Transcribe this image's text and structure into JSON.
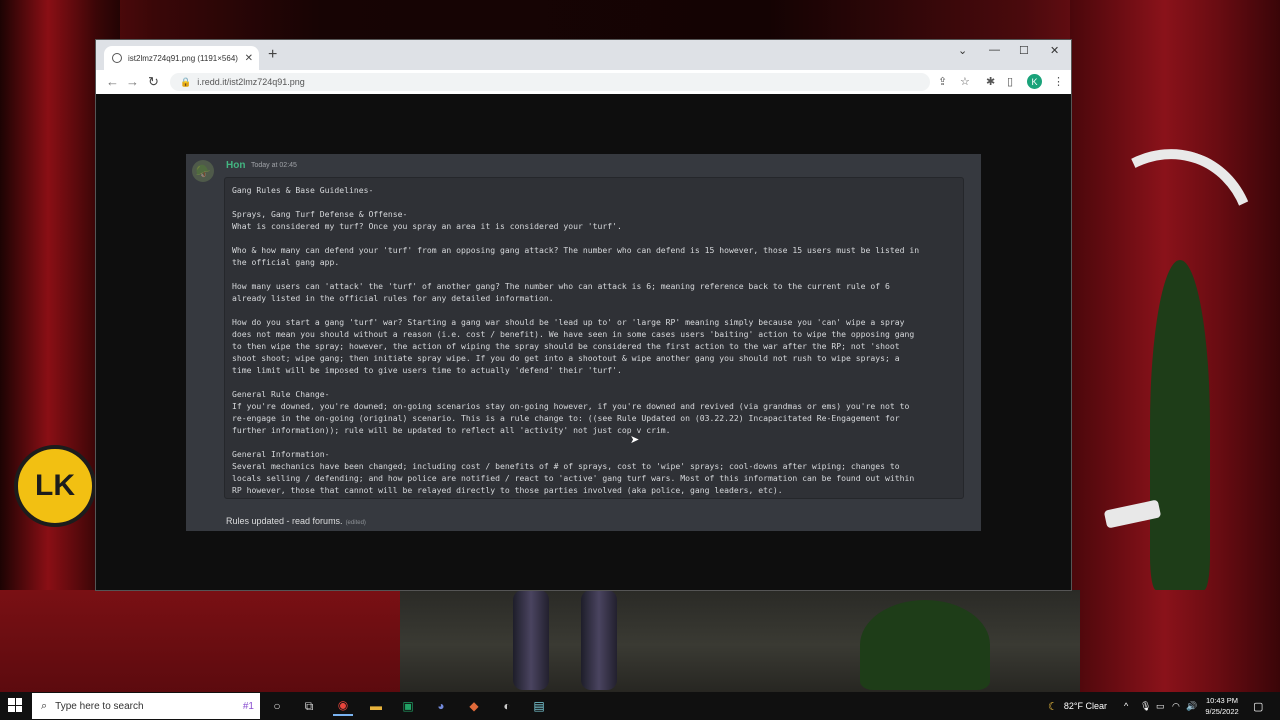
{
  "browser": {
    "tab_title": "ist2lmz724q91.png (1191×564)",
    "url": "i.redd.it/ist2lmz724q91.png",
    "profile_initial": "K"
  },
  "message": {
    "author": "Hon",
    "timestamp": "Today at 02:45",
    "body": "Gang Rules & Base Guidelines-\n\nSprays, Gang Turf Defense & Offense-\nWhat is considered my turf? Once you spray an area it is considered your 'turf'.\n\nWho & how many can defend your 'turf' from an opposing gang attack? The number who can defend is 15 however, those 15 users must be listed in\nthe official gang app.\n\nHow many users can 'attack' the 'turf' of another gang? The number who can attack is 6; meaning reference back to the current rule of 6\nalready listed in the official rules for any detailed information.\n\nHow do you start a gang 'turf' war? Starting a gang war should be 'lead up to' or 'large RP' meaning simply because you 'can' wipe a spray\ndoes not mean you should without a reason (i.e. cost / benefit). We have seen in some cases users 'baiting' action to wipe the opposing gang\nto then wipe the spray; however, the action of wiping the spray should be considered the first action to the war after the RP; not 'shoot\nshoot shoot; wipe gang; then initiate spray wipe. If you do get into a shootout & wipe another gang you should not rush to wipe sprays; a\ntime limit will be imposed to give users time to actually 'defend' their 'turf'.\n\nGeneral Rule Change-\nIf you're downed, you're downed; on-going scenarios stay on-going however, if you're downed and revived (via grandmas or ems) you're not to\nre-engage in the on-going (original) scenario. This is a rule change to: ((see Rule Updated on (03.22.22) Incapacitated Re-Engagement for\nfurther information)); rule will be updated to reflect all 'activity' not just cop v crim.\n\nGeneral Information-\nSeveral mechanics have been changed; including cost / benefits of # of sprays, cost to 'wipe' sprays; cool-downs after wiping; changes to\nlocals selling / defending; and how police are notified / react to 'active' gang turf wars. Most of this information can be found out within\nRP however, those that cannot will be relayed directly to those parties involved (aka police, gang leaders, etc).",
    "footer": "Rules updated - read forums.",
    "edited": "(edited)"
  },
  "desktop": {
    "badge_text": "LK"
  },
  "taskbar": {
    "search_placeholder": "Type here to search",
    "search_deco": "#1",
    "weather": "82°F  Clear",
    "time": "10:43 PM",
    "date": "9/25/2022"
  },
  "colors": {
    "author_green": "#43b581",
    "discord_bg": "#36393f",
    "codeblock_bg": "#2f3136"
  },
  "icons": [
    "globe-icon",
    "close-icon",
    "plus-icon",
    "chevron-down-icon",
    "minimize-icon",
    "maximize-icon",
    "back-icon",
    "forward-icon",
    "reload-icon",
    "lock-icon",
    "share-icon",
    "star-icon",
    "extensions-icon",
    "sidebar-icon",
    "menu-icon",
    "windows-icon",
    "search-icon",
    "cortana-icon",
    "task-view-icon",
    "chrome-icon",
    "folder-icon",
    "excel-icon",
    "discord-icon",
    "moon-icon",
    "wifi-icon",
    "volume-icon",
    "notification-icon"
  ]
}
